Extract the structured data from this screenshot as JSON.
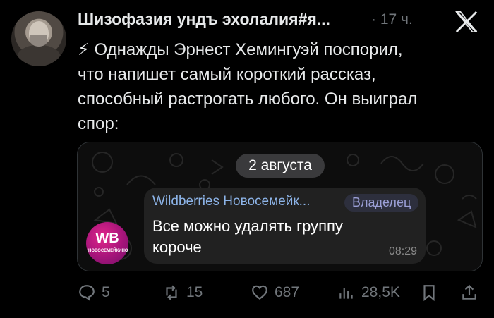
{
  "author": {
    "name": "Шизофазия ундъ эхолалия#я...",
    "timestamp": "· 17 ч."
  },
  "post": {
    "text": "⚡ Однажды Эрнест Хемингуэй поспорил,\nчто напишет самый короткий рассказ,\nспособный растрогать любого. Он выиграл\nспор:"
  },
  "media": {
    "date_pill": "2 августа",
    "sender": "Wildberries Новосемейк...",
    "role": "Владелец",
    "message": "Все можно удалять группу\nкороче",
    "time": "08:29",
    "avatar_logo": "WB",
    "avatar_sub": "НОВОСЕМЕЙКИНО"
  },
  "actions": {
    "replies": "5",
    "reposts": "15",
    "likes": "687",
    "views": "28,5K"
  },
  "icons": {
    "close": "x-logo",
    "bolt": "lightning-icon",
    "reply": "reply-icon",
    "repost": "repost-icon",
    "like": "heart-icon",
    "views": "views-icon",
    "bookmark": "bookmark-icon",
    "share": "share-icon"
  },
  "colors": {
    "background": "#000000",
    "secondary_text": "#71767b",
    "sender_blue": "#8db4e8",
    "wb_pink": "#c0177f"
  }
}
